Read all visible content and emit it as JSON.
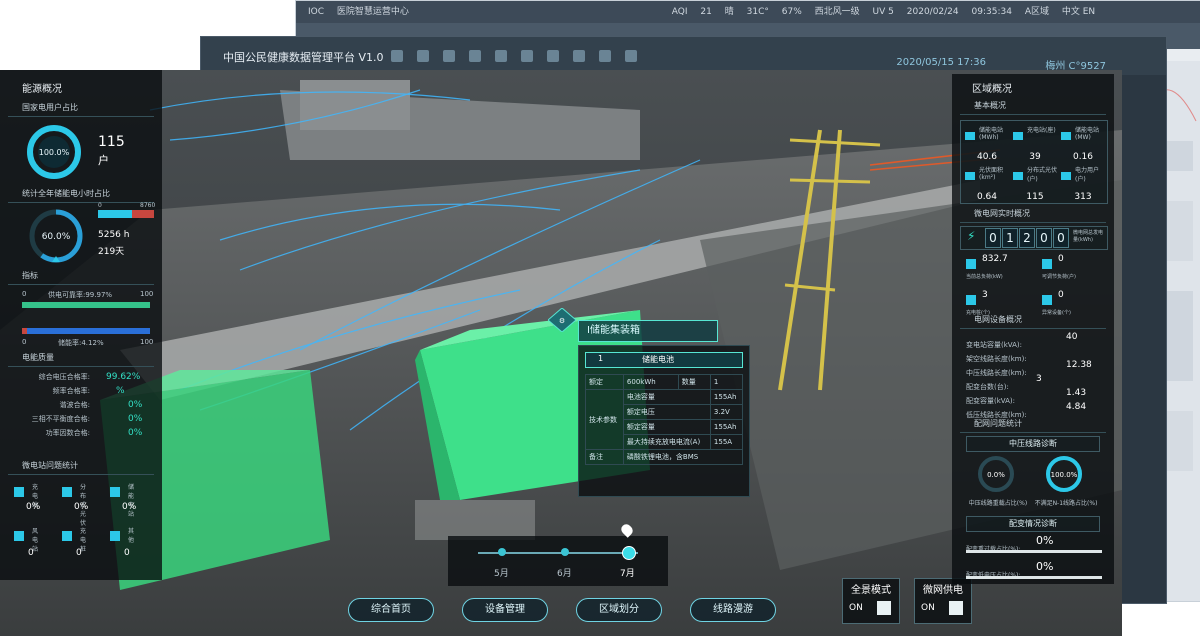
{
  "back_window": {
    "title_bar": [
      "IOC",
      "医院智慧运营中心",
      "AQI",
      "21",
      "晴",
      "31C°",
      "67%",
      "西北风一级",
      "UV 5",
      "2020/02/24",
      "09:35:34",
      "A区域",
      "中文 EN"
    ]
  },
  "mid_window": {
    "logo_text": "中国公民健康数据管理平台 V1.0",
    "datetime": "2020/05/15  17:36",
    "city": "梅州 C°9527"
  },
  "left_panel": {
    "title": "能源概况",
    "section1": {
      "title": "国家电用户占比",
      "gauge_value": "100.0%",
      "progress": 1.0,
      "count": "115",
      "unit": "户"
    },
    "section2": {
      "title": "统计全年储能电小时占比",
      "gauge_value": "60.0%",
      "progress": 0.6,
      "hours": "5256 h",
      "days": "219天",
      "bar_left": "0",
      "bar_right": "8760"
    },
    "section3": {
      "title": "指标",
      "bar1_left": "0",
      "bar1_label": "供电可靠率:99.97%",
      "bar1_right": "100",
      "bar1_fill": 0.9997,
      "bar2_left": "0",
      "bar2_label": "储能率:4.12%",
      "bar2_right": "100",
      "bar2_fill": 0.0412
    },
    "section4": {
      "title": "电能质量",
      "rows": [
        {
          "label": "综合电压合格率:",
          "value": "99.62%"
        },
        {
          "label": "频率合格率:",
          "value": "%"
        },
        {
          "label": "谐波合格:",
          "value": "0%"
        },
        {
          "label": "三相不平衡度合格:",
          "value": "0%"
        },
        {
          "label": "功率因数合格:",
          "value": "0%"
        }
      ]
    },
    "section5": {
      "title": "微电站问题统计",
      "items": [
        {
          "label": "充电站",
          "value": "0%"
        },
        {
          "label": "分布式光伏",
          "value": "0%"
        },
        {
          "label": "储能电站",
          "value": "0%"
        },
        {
          "label": "风电站",
          "value": "0"
        },
        {
          "label": "充电桩",
          "value": "0"
        },
        {
          "label": "其他",
          "value": "0"
        }
      ]
    }
  },
  "center": {
    "popup_title": "Ⅰ储能集装箱",
    "popup_header_no": "1",
    "popup_header_name": "储能电池",
    "popup_rows": [
      {
        "c1": "额定",
        "c2": "600kWh",
        "c3": "数量",
        "c4": "1"
      },
      {
        "c1": "技术参数",
        "c2": "电池容量",
        "c3": "",
        "c4": "155Ah"
      },
      {
        "c1": "",
        "c2": "额定电压",
        "c3": "",
        "c4": "3.2V"
      },
      {
        "c1": "",
        "c2": "额定容量",
        "c3": "",
        "c4": "155Ah"
      },
      {
        "c1": "",
        "c2": "最大持续充放电电流(A)",
        "c3": "",
        "c4": "155A"
      },
      {
        "c1": "备注",
        "c2": "磷酸铁锂电池，含BMS",
        "c3": "",
        "c4": ""
      }
    ],
    "timeline": [
      "5月",
      "6月",
      "7月"
    ],
    "timeline_active": 2
  },
  "bottom_nav": [
    "综合首页",
    "设备管理",
    "区域划分",
    "线路漫游"
  ],
  "mode_switches": [
    {
      "label": "全景模式",
      "state": "ON"
    },
    {
      "label": "微网供电",
      "state": "ON"
    }
  ],
  "right_panel": {
    "title": "区域概况",
    "basic_title": "基本概况",
    "stats": [
      {
        "label": "储能电站(MWh)",
        "value": "40.6"
      },
      {
        "label": "充电站(座)",
        "value": "39"
      },
      {
        "label": "储能电站(MW)",
        "value": "0.16"
      },
      {
        "label": "光伏面积(km²)",
        "value": "0.64"
      },
      {
        "label": "分布式光伏(户)",
        "value": "115"
      },
      {
        "label": "电力用户(户)",
        "value": "313"
      }
    ],
    "realtime_title": "微电网实时概况",
    "digits": [
      "0",
      "1",
      "2",
      "0",
      "0"
    ],
    "digits_label": "微电网总发电量(kWh)",
    "kpis": [
      {
        "value": "832.7",
        "label": "当前总负荷(kW)"
      },
      {
        "value": "0",
        "label": "可调节负荷(户)"
      },
      {
        "value": "3",
        "label": "充电桩(个)"
      },
      {
        "value": "0",
        "label": "异常设备(个)"
      }
    ],
    "device_title": "电网设备概况",
    "devices": [
      {
        "label": "变电站容量(kVA):",
        "value": "40"
      },
      {
        "label": "架空线路长度(km):",
        "value": ""
      },
      {
        "label": "中压线路长度(km):",
        "value": "12.38"
      },
      {
        "label": "配变台数(台):",
        "value": "3"
      },
      {
        "label": "配变容量(kVA):",
        "value": "1.43"
      },
      {
        "label": "低压线路长度(km):",
        "value": "4.84"
      }
    ],
    "issue_title": "配网问题统计",
    "issue_sub": "中压线路诊断",
    "ring1": {
      "value": "0.0%",
      "label": "中压线路重载占比(%)",
      "progress": 0.0
    },
    "ring2": {
      "value": "100.0%",
      "label": "不满足N-1线路占比(%)",
      "progress": 1.0
    },
    "issue_sub2": "配变情况诊断",
    "bars": [
      {
        "label": "配变重过载占比(%):",
        "value": "0%"
      },
      {
        "label": "配变低电压占比(%):",
        "value": "0%"
      }
    ]
  },
  "colors": {
    "accent": "#33e0c6",
    "container": "#3ee08a",
    "panel": "#0b1114"
  }
}
